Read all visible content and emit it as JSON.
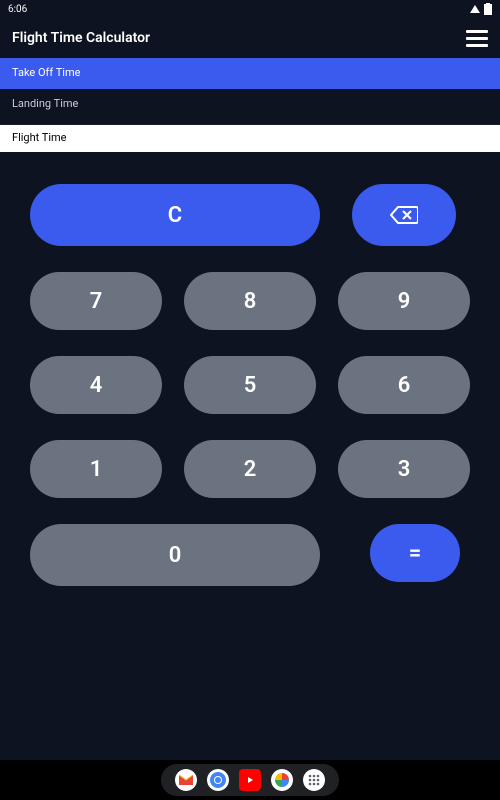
{
  "status": {
    "time": "6:06"
  },
  "header": {
    "title": "Flight Time Calculator"
  },
  "fields": {
    "takeoff": "Take Off Time",
    "landing": "Landing Time",
    "flight": "Flight Time"
  },
  "keypad": {
    "clear": "C",
    "n7": "7",
    "n8": "8",
    "n9": "9",
    "n4": "4",
    "n5": "5",
    "n6": "6",
    "n1": "1",
    "n2": "2",
    "n3": "3",
    "n0": "0",
    "equals": "="
  }
}
